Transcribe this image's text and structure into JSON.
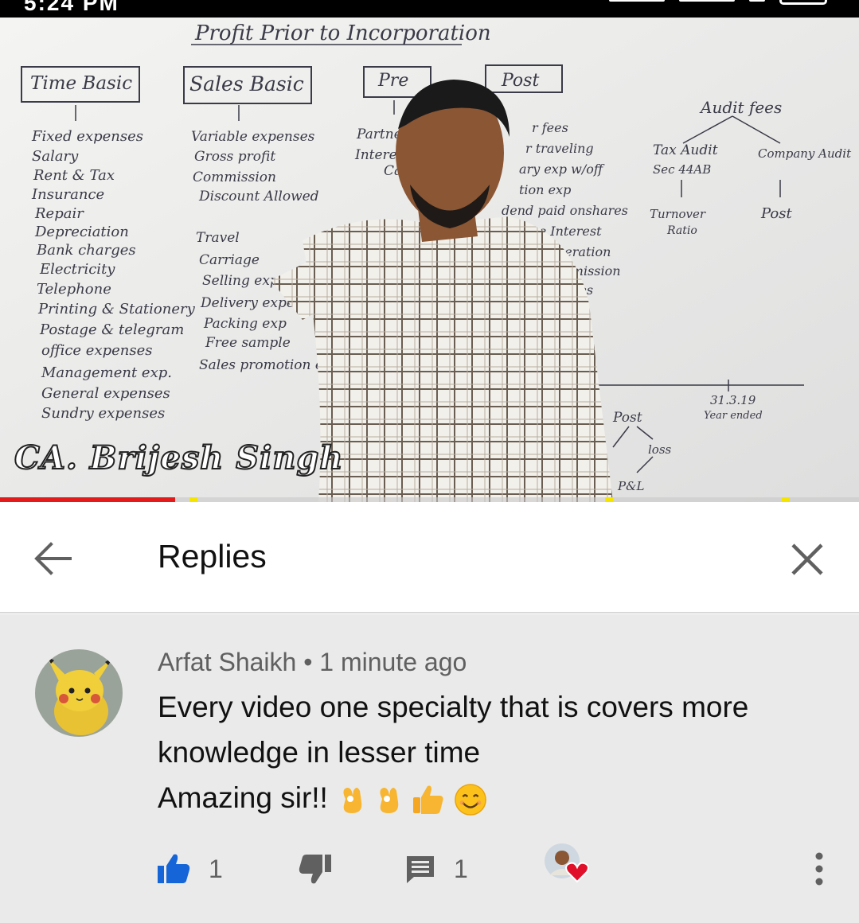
{
  "status_bar": {
    "time": "5:24 PM"
  },
  "video": {
    "watermark": "CA. Brijesh Singh",
    "progress": 0.204,
    "board": {
      "title": "Profit Prior to Incorporation",
      "box_time": "Time Basic",
      "box_sales": "Sales Basic",
      "box_pre": "Pre",
      "box_post": "Post",
      "time_items": [
        "Fixed expenses",
        "Salary",
        "Rent & Tax",
        "Insurance",
        "Repair",
        "Depreciation",
        "Bank charges",
        "Electricity",
        "Telephone",
        "Printing & Stationery",
        "Postage & telegram",
        "office expenses",
        "Management exp.",
        "General expenses",
        "Sundry expenses"
      ],
      "sales_items": [
        "Variable expenses",
        "Gross profit",
        "Commission",
        "Discount Allowed",
        "Travel",
        "Carriage",
        "Selling expenses",
        "Delivery expenses",
        "Packing exp",
        "Free sample",
        "Sales promotion exp."
      ],
      "pre_items": [
        "Partner",
        "Interest",
        "Cap"
      ],
      "post_items": [
        "r fees",
        "r traveling",
        "ary exp w/off",
        "tion exp",
        "dend paid onshares",
        "nture Interest",
        "Remuneration",
        "r Commission",
        "fees"
      ],
      "audit_title": "Audit fees",
      "audit_left": "Tax Audit",
      "audit_left_sub": "Sec 44AB",
      "audit_left_result_1": "Turnover",
      "audit_left_result_2": "Ratio",
      "audit_right": "Company Audit",
      "audit_right_result": "Post",
      "timeline_date": "31.3.19",
      "timeline_label": "Year ended",
      "post_lower": "Post",
      "loss_lower": "loss",
      "pl_lower": "P&L"
    }
  },
  "replies": {
    "title": "Replies"
  },
  "comment": {
    "author": "Arfat Shaikh",
    "separator": "•",
    "time": "1 minute ago",
    "line1": "Every video one specialty that is covers more",
    "line2": "knowledge in lesser time",
    "line3": "Amazing sir!!",
    "emojis": [
      "ok-hand-emoji",
      "ok-hand-emoji",
      "thumbs-up-emoji",
      "smiling-face-emoji"
    ],
    "likes": "1",
    "replies": "1"
  },
  "colors": {
    "like_blue": "#1565d8",
    "icon_grey": "#606060",
    "progress_red": "#e31b1b",
    "heart_red": "#e0102a",
    "comment_bg": "#eaeaea"
  }
}
